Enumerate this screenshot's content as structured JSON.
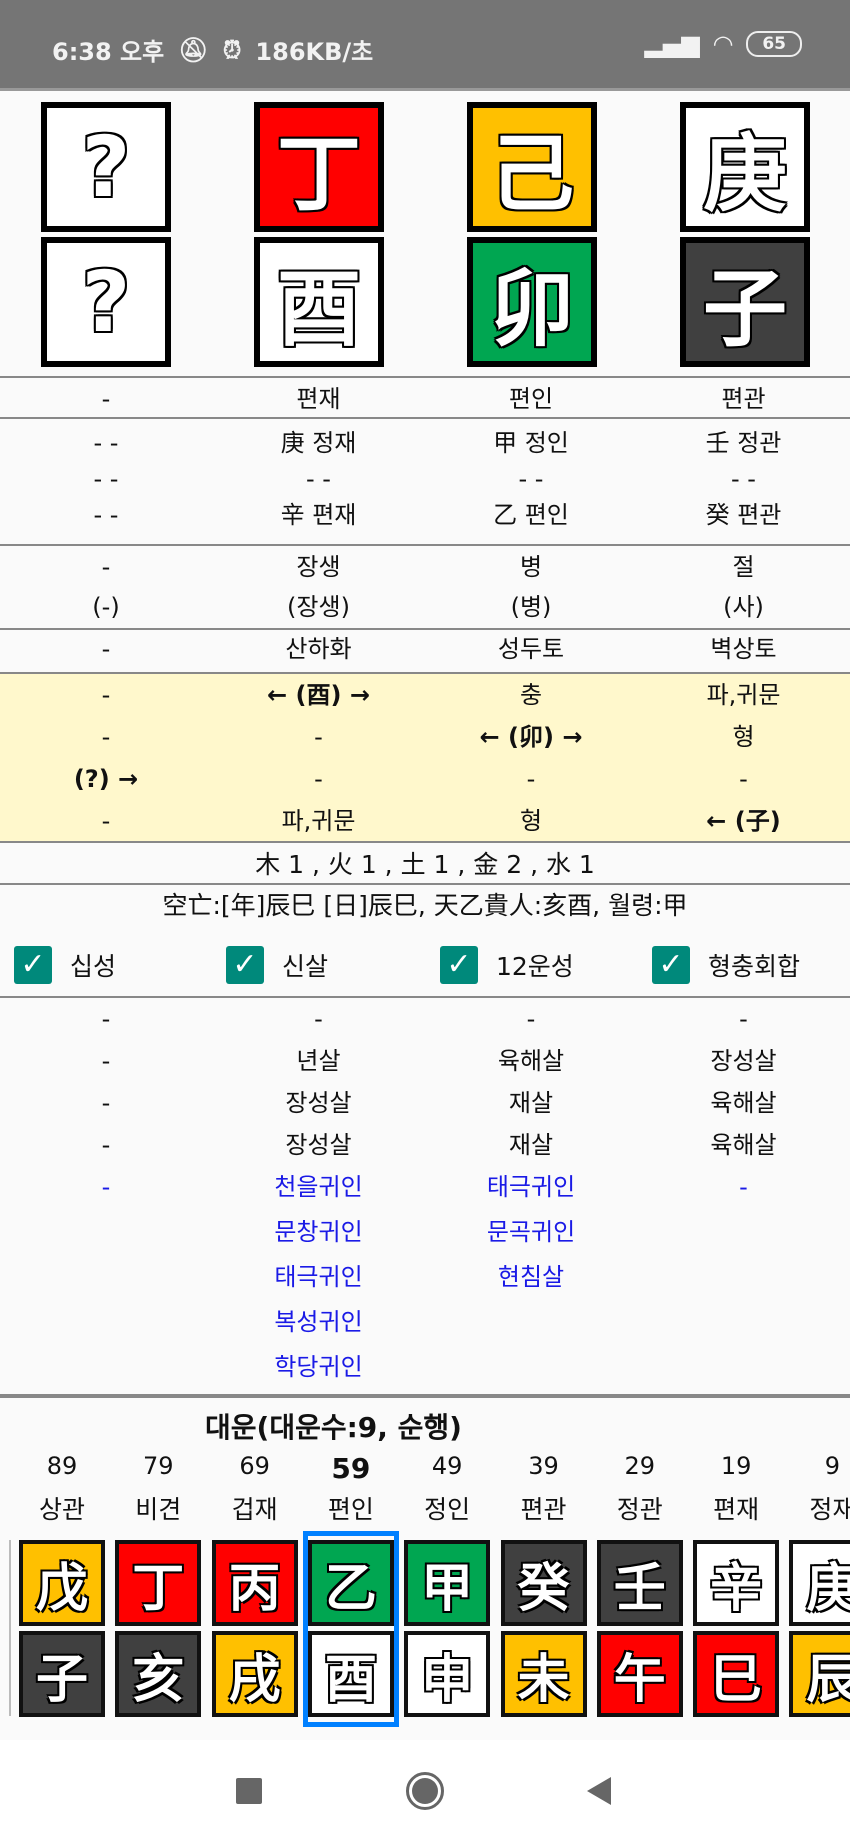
{
  "status": {
    "time": "6:38 오후",
    "speed": "186KB/초",
    "battery": "65",
    "mute_icon": "bell-off-icon",
    "alarm_icon": "alarm-icon",
    "signal_icon": "signal-icon",
    "wifi_icon": "wifi-icon"
  },
  "pillars": [
    {
      "stem": "?",
      "stem_color": "#ffffff",
      "branch": "?",
      "branch_color": "#ffffff"
    },
    {
      "stem": "丁",
      "stem_color": "#ff0000",
      "branch": "酉",
      "branch_color": "#ffffff"
    },
    {
      "stem": "己",
      "stem_color": "#ffc000",
      "branch": "卯",
      "branch_color": "#00a651"
    },
    {
      "stem": "庚",
      "stem_color": "#ffffff",
      "branch": "子",
      "branch_color": "#404040"
    }
  ],
  "sipsung": [
    "-",
    "편재",
    "편인",
    "편관"
  ],
  "jijanggan": [
    [
      "- -",
      "- -",
      "- -"
    ],
    [
      "庚 정재",
      "- -",
      "辛 편재"
    ],
    [
      "甲 정인",
      "- -",
      "乙 편인"
    ],
    [
      "壬 정관",
      "- -",
      "癸 편관"
    ]
  ],
  "unsung": [
    [
      "-",
      "(-)"
    ],
    [
      "장생",
      "(장생)"
    ],
    [
      "병",
      "(병)"
    ],
    [
      "절",
      "(사)"
    ]
  ],
  "napeum": [
    "-",
    "산하화",
    "성두토",
    "벽상토"
  ],
  "relations": [
    [
      "-",
      "-",
      "(?) →",
      "-"
    ],
    [
      "← (酉) →",
      "-",
      "-",
      "파,귀문"
    ],
    [
      "충",
      "← (卯) →",
      "-",
      "형"
    ],
    [
      "파,귀문",
      "형",
      "-",
      "← (子)"
    ]
  ],
  "elements": "木 1 , 火 1 , 土 1 , 金 2 , 水 1",
  "info": "空亡:[年]辰巳 [日]辰巳, 天乙貴人:亥酉, 월령:甲",
  "checkboxes": [
    {
      "label": "십성",
      "checked": true
    },
    {
      "label": "신살",
      "checked": true
    },
    {
      "label": "12운성",
      "checked": true
    },
    {
      "label": "형충회합",
      "checked": true
    }
  ],
  "sinsal": [
    {
      "black": [
        "-",
        "-",
        "-",
        "-"
      ],
      "blue": [
        "-"
      ]
    },
    {
      "black": [
        "-",
        "년살",
        "장성살",
        "장성살"
      ],
      "blue": [
        "천을귀인",
        "문창귀인",
        "태극귀인",
        "복성귀인",
        "학당귀인"
      ]
    },
    {
      "black": [
        "-",
        "육해살",
        "재살",
        "재살"
      ],
      "blue": [
        "태극귀인",
        "문곡귀인",
        "현침살"
      ]
    },
    {
      "black": [
        "-",
        "장성살",
        "육해살",
        "육해살"
      ],
      "blue": [
        "-"
      ]
    }
  ],
  "daewoon": {
    "title": "대운(대운수:9, 순행)",
    "selected_age": "59",
    "columns": [
      {
        "age": "89",
        "label": "상관",
        "stem": "戊",
        "stem_color": "#ffc000",
        "branch": "子",
        "branch_color": "#404040"
      },
      {
        "age": "79",
        "label": "비견",
        "stem": "丁",
        "stem_color": "#ff0000",
        "branch": "亥",
        "branch_color": "#404040"
      },
      {
        "age": "69",
        "label": "겁재",
        "stem": "丙",
        "stem_color": "#ff0000",
        "branch": "戌",
        "branch_color": "#ffc000"
      },
      {
        "age": "59",
        "label": "편인",
        "stem": "乙",
        "stem_color": "#00a651",
        "branch": "酉",
        "branch_color": "#ffffff"
      },
      {
        "age": "49",
        "label": "정인",
        "stem": "甲",
        "stem_color": "#00a651",
        "branch": "申",
        "branch_color": "#ffffff"
      },
      {
        "age": "39",
        "label": "편관",
        "stem": "癸",
        "stem_color": "#404040",
        "branch": "未",
        "branch_color": "#ffc000"
      },
      {
        "age": "29",
        "label": "정관",
        "stem": "壬",
        "stem_color": "#404040",
        "branch": "午",
        "branch_color": "#ff0000"
      },
      {
        "age": "19",
        "label": "편재",
        "stem": "辛",
        "stem_color": "#ffffff",
        "branch": "巳",
        "branch_color": "#ff0000"
      },
      {
        "age": "9",
        "label": "정재",
        "stem": "庚",
        "stem_color": "#ffffff",
        "branch": "辰",
        "branch_color": "#ffc000"
      }
    ]
  },
  "nav": {
    "recents_icon": "square-icon",
    "home_icon": "circle-icon",
    "back_icon": "triangle-back-icon"
  }
}
